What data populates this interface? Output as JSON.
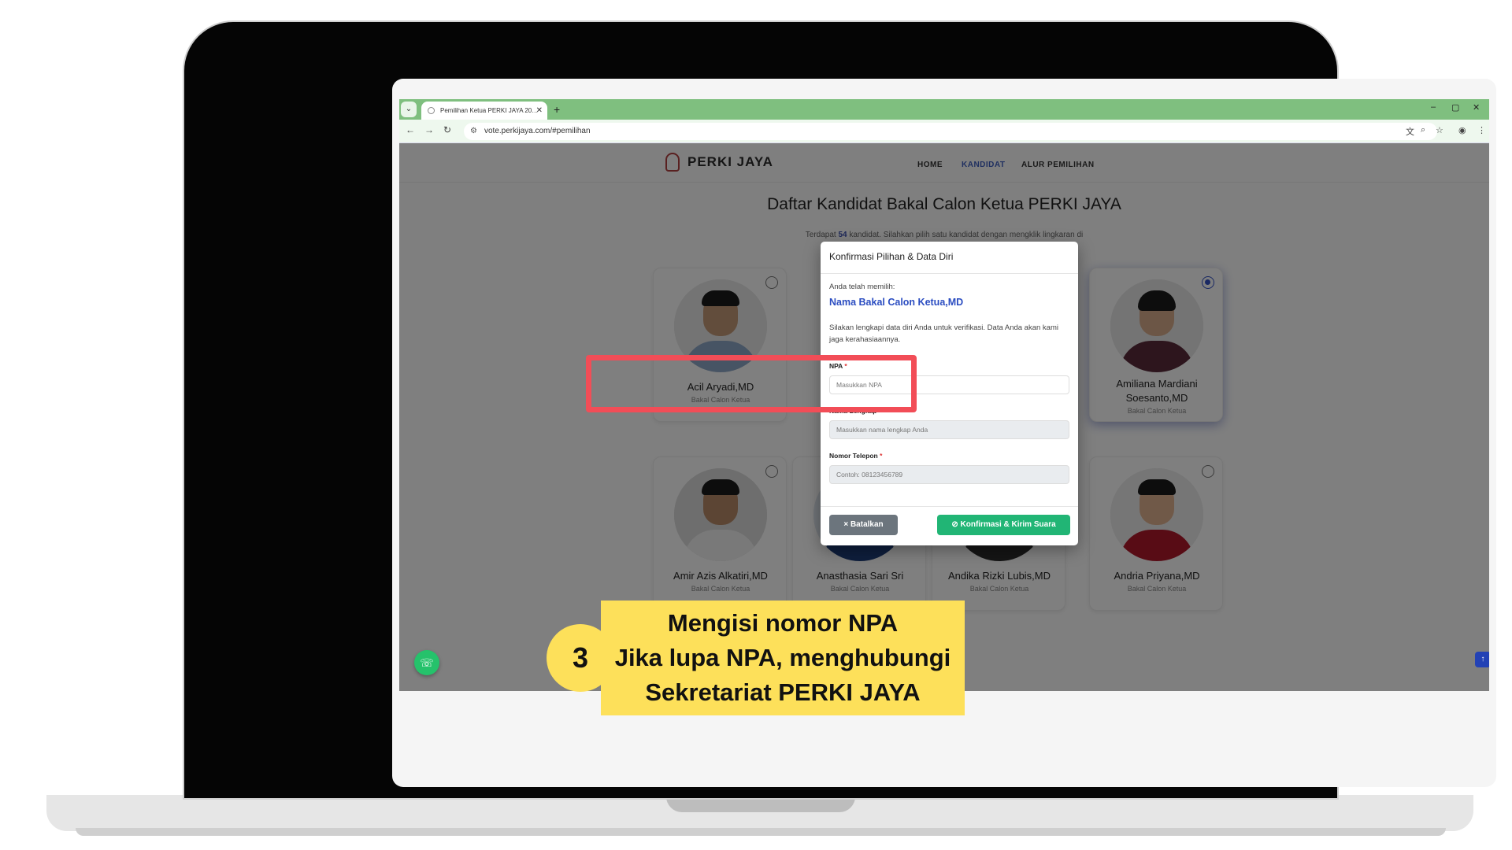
{
  "browser": {
    "tab_title": "Pemilihan Ketua PERKI JAYA 20…",
    "url": "vote.perkijaya.com/#pemilihan",
    "new_tab_glyph": "+",
    "tab_close_glyph": "✕",
    "tab_menu_glyph": "⌄",
    "back_glyph": "←",
    "forward_glyph": "→",
    "reload_glyph": "↻",
    "minimize_glyph": "–",
    "maximize_glyph": "▢",
    "close_glyph": "✕",
    "theme_color": "#7fbf7f"
  },
  "site": {
    "logo_text": "PERKI JAYA",
    "nav": [
      "HOME",
      "KANDIDAT",
      "ALUR PEMILIHAN"
    ],
    "active_nav": "KANDIDAT",
    "title": "Daftar Kandidat Bakal Calon Ketua PERKI JAYA",
    "subtitle_pre": "Terdapat ",
    "subtitle_count": "54",
    "subtitle_post": " kandidat. Silahkan pilih satu kandidat dengan mengklik lingkaran di pojok kanan atas atau pada area kartu."
  },
  "candidates": [
    {
      "name": "Acil Aryadi,MD",
      "role": "Bakal Calon Ketua",
      "selected": false
    },
    {
      "name": "Amiliana Mardiani Soesanto,MD",
      "role": "Bakal Calon Ketua",
      "selected": true
    },
    {
      "name": "Amir Azis Alkatiri,MD",
      "role": "Bakal Calon Ketua",
      "selected": false
    },
    {
      "name": "Anasthasia Sari Sri",
      "role": "Bakal Calon Ketua",
      "selected": false
    },
    {
      "name": "Andika Rizki Lubis,MD",
      "role": "Bakal Calon Ketua",
      "selected": false
    },
    {
      "name": "Andria Priyana,MD",
      "role": "Bakal Calon Ketua",
      "selected": false
    }
  ],
  "modal": {
    "title": "Konfirmasi Pilihan & Data Diri",
    "chosen_label": "Anda telah memilih:",
    "chosen_name": "Nama Bakal Calon Ketua,MD",
    "info": "Silakan lengkapi data diri Anda untuk verifikasi. Data Anda akan kami jaga kerahasiaannya.",
    "fields": [
      {
        "label": "NPA",
        "placeholder": "Masukkan NPA"
      },
      {
        "label": "Nama Lengkap",
        "placeholder": "Masukkan nama lengkap Anda"
      },
      {
        "label": "Nomor Telepon",
        "placeholder": "Contoh: 08123456789"
      }
    ],
    "required_mark": "*",
    "cancel_label": "× Batalkan",
    "confirm_label": "⊘ Konfirmasi & Kirim Suara"
  },
  "floating": {
    "whatsapp_icon": "☏",
    "scroll_top_icon": "↑"
  },
  "annotation": {
    "step": "3",
    "lines": [
      "Mengisi nomor NPA",
      "Jika lupa NPA, menghubungi",
      "Sekretariat PERKI JAYA"
    ],
    "highlight_color": "#f24d57",
    "caption_color": "#fde05a"
  },
  "colors": {
    "accent": "#2b4dc1",
    "confirm": "#21b575",
    "cancel": "#6c757d",
    "whatsapp": "#25c26b"
  }
}
